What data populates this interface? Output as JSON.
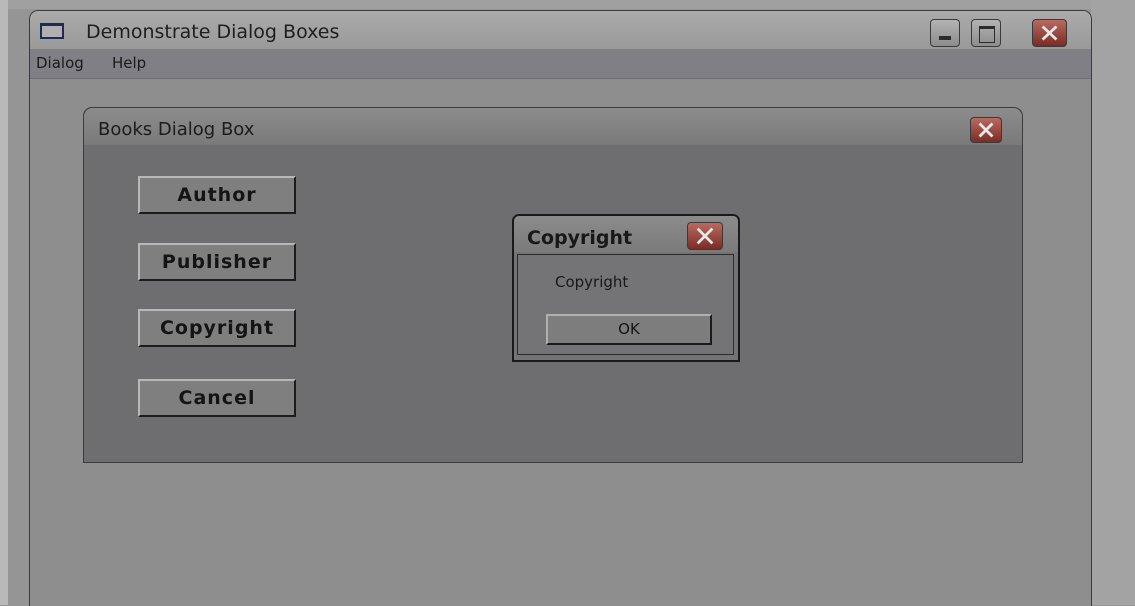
{
  "main_window": {
    "title": "Demonstrate Dialog Boxes",
    "menu": [
      "Dialog",
      "Help"
    ]
  },
  "books_dialog": {
    "title": "Books Dialog Box",
    "buttons": [
      "Author",
      "Publisher",
      "Copyright",
      "Cancel"
    ]
  },
  "copyright_dialog": {
    "title": "Copyright",
    "message": "Copyright",
    "ok_label": "OK"
  },
  "colors": {
    "close_button": "#9a4339",
    "title_icon": "#1f2a57"
  }
}
